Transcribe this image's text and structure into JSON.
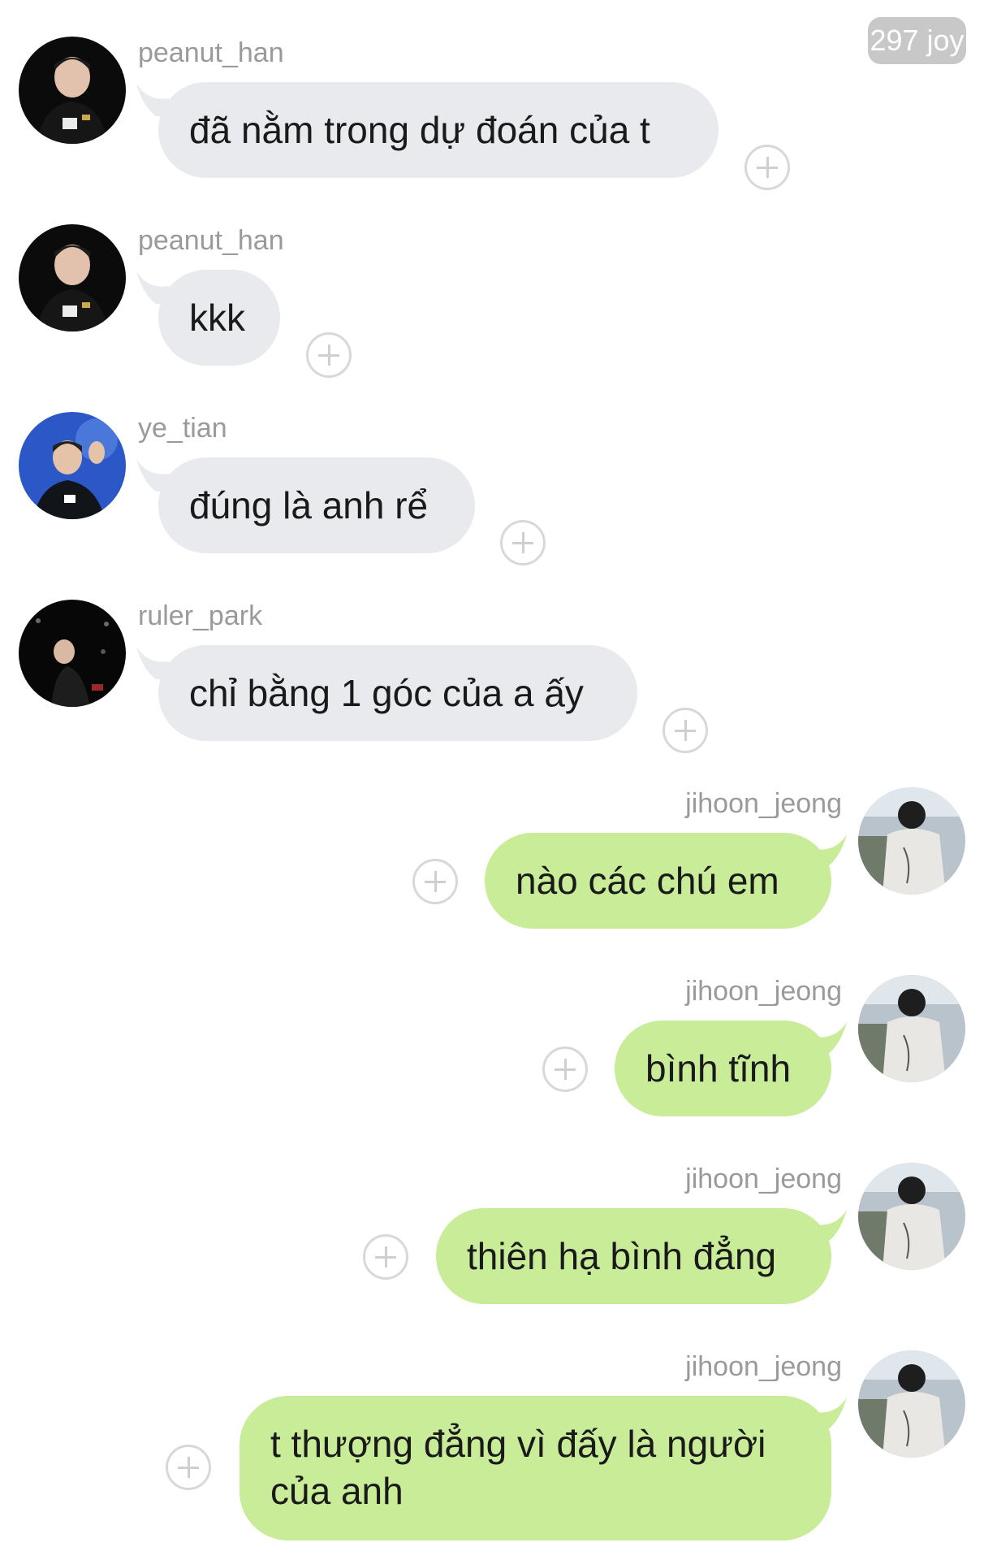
{
  "header": {
    "badge": "297 joy"
  },
  "colors": {
    "incoming_bubble": "#e8eaed",
    "outgoing_bubble": "#c8ec98",
    "username_text": "#9a9a9a",
    "badge_background": "#c8c8c8"
  },
  "messages": [
    {
      "sender": "peanut_han",
      "text": "đã nằm trong dự đoán của t",
      "side": "left",
      "avatar_icon": "peanut-han-avatar"
    },
    {
      "sender": "peanut_han",
      "text": "kkk",
      "side": "left",
      "avatar_icon": "peanut-han-avatar"
    },
    {
      "sender": "ye_tian",
      "text": "đúng là anh rể",
      "side": "left",
      "avatar_icon": "ye-tian-avatar"
    },
    {
      "sender": "ruler_park",
      "text": "chỉ bằng 1 góc của a ấy",
      "side": "left",
      "avatar_icon": "ruler-park-avatar"
    },
    {
      "sender": "jihoon_jeong",
      "text": "nào các chú em",
      "side": "right",
      "avatar_icon": "jihoon-jeong-avatar"
    },
    {
      "sender": "jihoon_jeong",
      "text": "bình tĩnh",
      "side": "right",
      "avatar_icon": "jihoon-jeong-avatar"
    },
    {
      "sender": "jihoon_jeong",
      "text": "thiên hạ bình đẳng",
      "side": "right",
      "avatar_icon": "jihoon-jeong-avatar"
    },
    {
      "sender": "jihoon_jeong",
      "text_lines": [
        "t thượng đẳng vì đấy là người",
        "của anh"
      ],
      "side": "right",
      "avatar_icon": "jihoon-jeong-avatar"
    }
  ]
}
